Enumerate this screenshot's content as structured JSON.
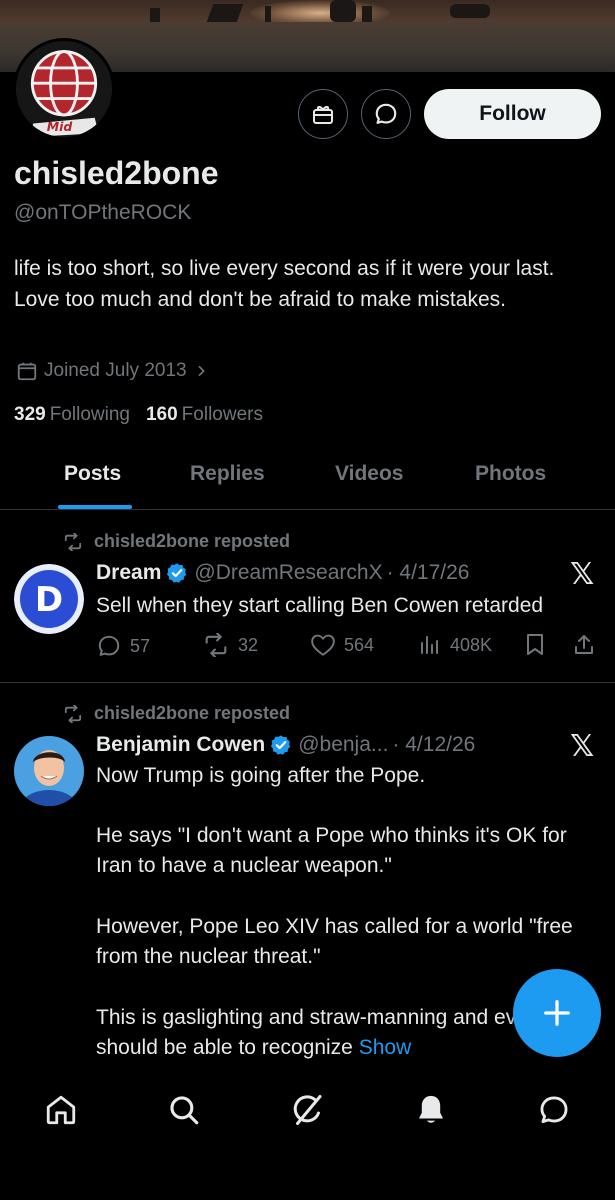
{
  "profile": {
    "name": "chisled2bone",
    "handle": "@onTOPtheROCK",
    "bio": "life is too short, so live every second as if it were your last. Love too much and don't be afraid to make mistakes.",
    "joined": "Joined July 2013",
    "following_count": "329",
    "following_label": "Following",
    "followers_count": "160",
    "followers_label": "Followers",
    "follow_label": "Follow",
    "avatar_text": "Mid"
  },
  "tabs": [
    {
      "label": "Posts",
      "active": true
    },
    {
      "label": "Replies",
      "active": false
    },
    {
      "label": "Videos",
      "active": false
    },
    {
      "label": "Photos",
      "active": false
    }
  ],
  "posts": [
    {
      "repost_label": "chisled2bone reposted",
      "author": "Dream",
      "handle": "@DreamResearchX",
      "date": "· 4/17/26",
      "avatar_letter": "D",
      "text": "Sell when they start calling Ben Cowen retarded",
      "replies": "57",
      "reposts": "32",
      "likes": "564",
      "views": "408K"
    },
    {
      "repost_label": "chisled2bone reposted",
      "author": "Benjamin Cowen",
      "handle": "@benja...",
      "date": "· 4/12/26",
      "paragraphs": [
        "Now Trump is going after the Pope.",
        "He says \"I don't want a Pope who thinks it's OK for Iran to have a nuclear weapon.\"",
        "However, Pope Leo XIV has called for a world \"free from the nuclear threat.\"",
        "This is gaslighting and straw-manning and everyone should be able to recognize"
      ],
      "show_more": "Show"
    }
  ],
  "colors": {
    "accent": "#1d9bf0",
    "text_primary": "#e7e9ea",
    "text_secondary": "#71767b",
    "border": "#2f3336",
    "background": "#000000"
  },
  "icons": {
    "gift": "gift-icon",
    "message": "message-icon",
    "calendar": "calendar-icon",
    "chevron": "chevron-right-icon",
    "repost": "repost-icon",
    "verified": "verified-badge-icon",
    "x_logo": "x-logo-icon",
    "reply": "reply-icon",
    "like": "heart-icon",
    "views": "views-icon",
    "bookmark": "bookmark-icon",
    "share": "share-icon",
    "compose": "plus-icon",
    "home": "home-icon",
    "search": "search-icon",
    "grok": "grok-icon",
    "notifications": "bell-icon",
    "messages": "chat-icon"
  }
}
